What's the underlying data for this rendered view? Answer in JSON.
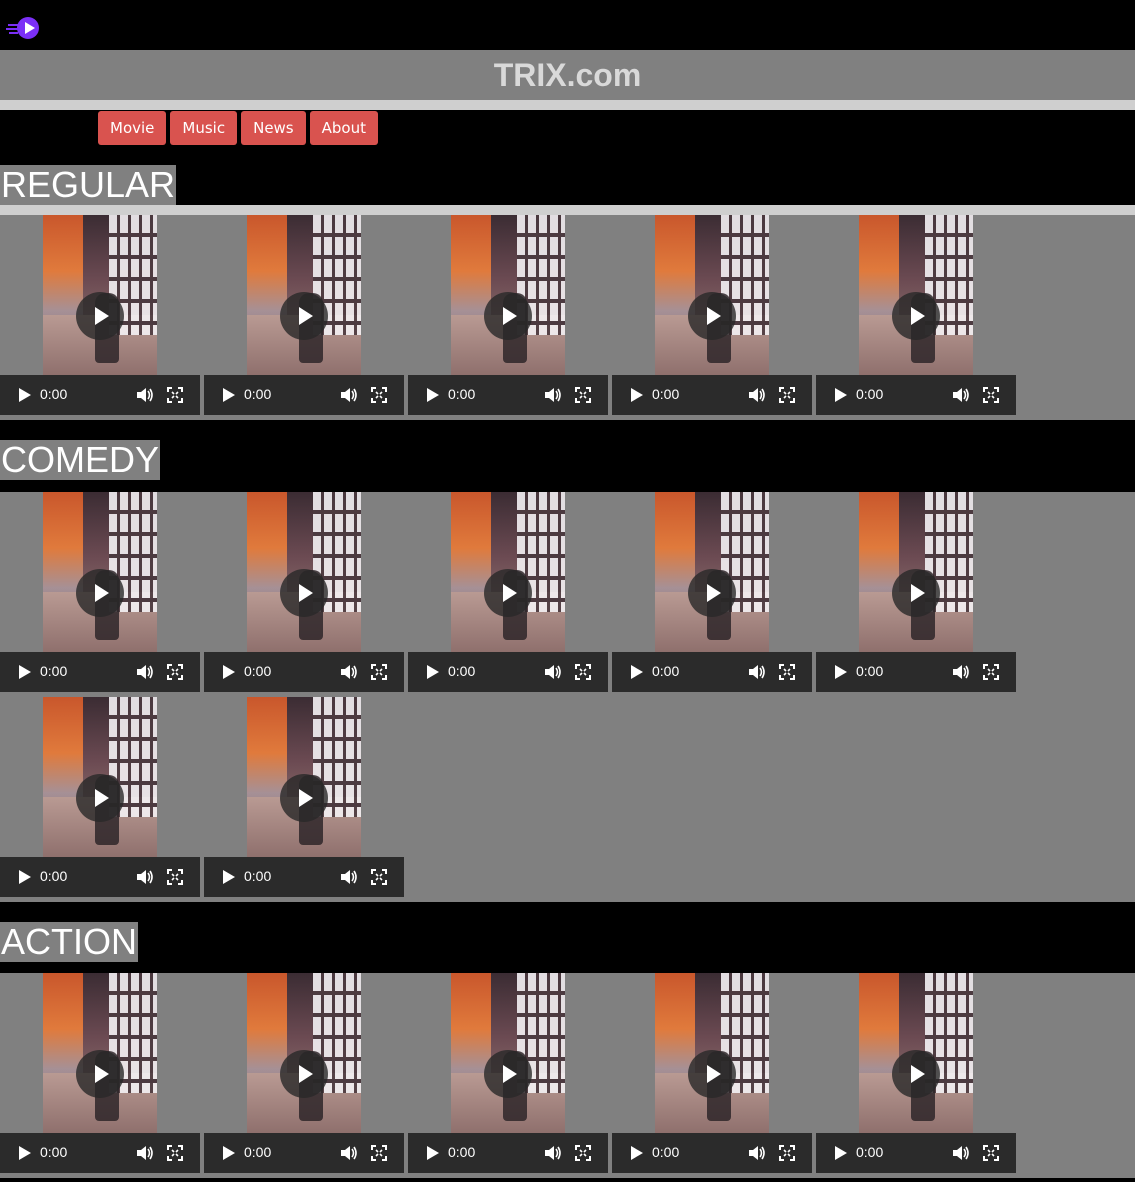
{
  "site": {
    "title": "TRIX.com",
    "logo_icon": "play-logo-icon",
    "logo_color": "#7b2ff7"
  },
  "nav": {
    "items": [
      {
        "label": "Movie"
      },
      {
        "label": "Music"
      },
      {
        "label": "News"
      },
      {
        "label": "About"
      }
    ],
    "button_color": "#d9534f"
  },
  "sections": [
    {
      "title": "REGULAR",
      "video_count": 5,
      "videos": [
        {
          "time": "0:00"
        },
        {
          "time": "0:00"
        },
        {
          "time": "0:00"
        },
        {
          "time": "0:00"
        },
        {
          "time": "0:00"
        }
      ]
    },
    {
      "title": "COMEDY",
      "video_count": 7,
      "videos": [
        {
          "time": "0:00"
        },
        {
          "time": "0:00"
        },
        {
          "time": "0:00"
        },
        {
          "time": "0:00"
        },
        {
          "time": "0:00"
        },
        {
          "time": "0:00"
        },
        {
          "time": "0:00"
        }
      ]
    },
    {
      "title": "ACTION",
      "video_count": 5,
      "videos": [
        {
          "time": "0:00"
        },
        {
          "time": "0:00"
        },
        {
          "time": "0:00"
        },
        {
          "time": "0:00"
        },
        {
          "time": "0:00"
        }
      ]
    }
  ],
  "video_controls": {
    "play_icon": "play-icon",
    "volume_icon": "volume-icon",
    "fullscreen_icon": "fullscreen-icon"
  }
}
